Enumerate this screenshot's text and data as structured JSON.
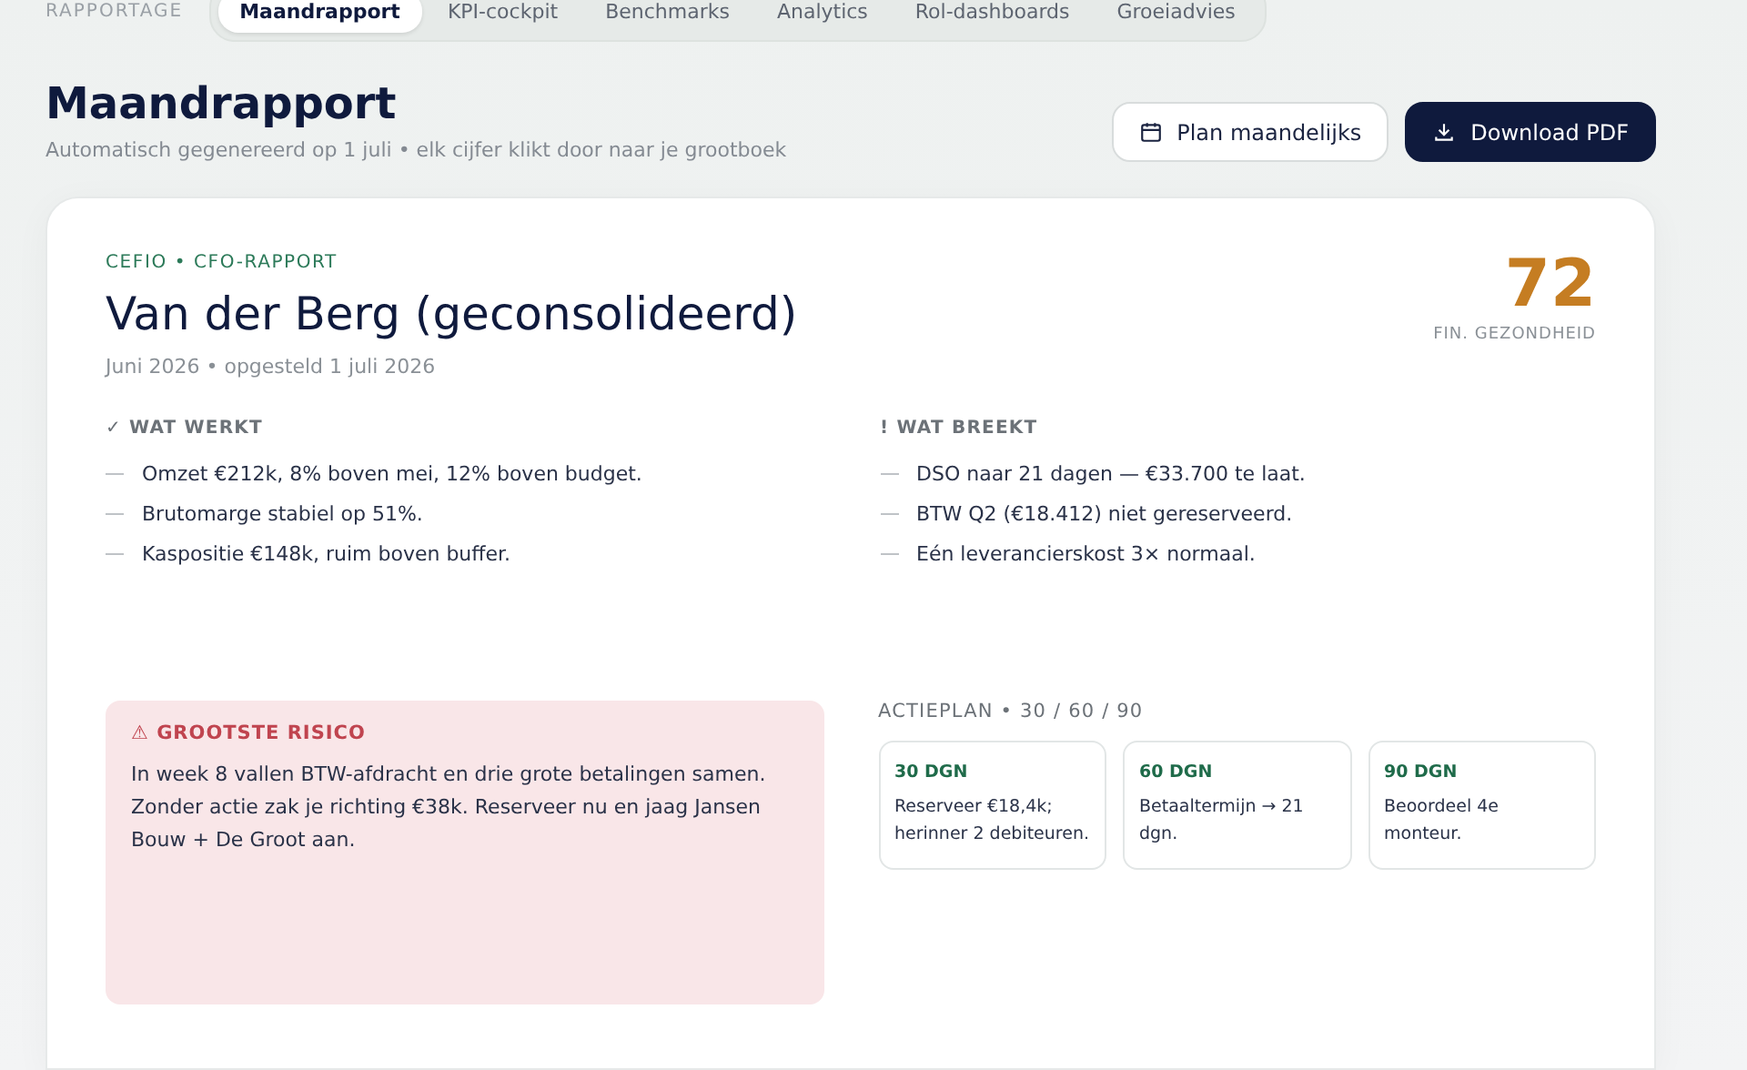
{
  "section_label": "RAPPORTAGE",
  "tabs": [
    {
      "label": "Maandrapport",
      "selected": true
    },
    {
      "label": "KPI-cockpit",
      "selected": false
    },
    {
      "label": "Benchmarks",
      "selected": false
    },
    {
      "label": "Analytics",
      "selected": false
    },
    {
      "label": "Rol-dashboards",
      "selected": false
    },
    {
      "label": "Groeiadvies",
      "selected": false
    }
  ],
  "header": {
    "title": "Maandrapport",
    "subtitle": "Automatisch gegenereerd op 1 juli • elk cijfer klikt door naar je grootboek"
  },
  "buttons": [
    {
      "label": "Plan maandelijks",
      "kind": "secondary"
    },
    {
      "label": "Download PDF",
      "kind": "primary"
    }
  ],
  "report": {
    "eyebrow": "CEFIO • CFO-RAPPORT",
    "title": "Van der Berg (geconsolideerd)",
    "meta": "Juni 2026 • opgesteld 1 juli 2026",
    "score": {
      "value": "72",
      "label": "FIN. GEZONDHEID"
    },
    "columns": [
      {
        "heading": "✓ WAT WERKT",
        "items": [
          "Omzet €212k, 8% boven mei, 12% boven budget.",
          "Brutomarge stabiel op 51%.",
          "Kaspositie €148k, ruim boven buffer."
        ]
      },
      {
        "heading": "! WAT BREEKT",
        "items": [
          "DSO naar 21 dagen — €33.700 te laat.",
          "BTW Q2 (€18.412) niet gereserveerd.",
          "Eén leverancierskost 3× normaal."
        ]
      }
    ],
    "risk": {
      "heading": "⚠ GROOTSTE RISICO",
      "text": "In week 8 vallen BTW-afdracht en drie grote betalingen samen. Zonder actie zak je richting €38k. Reserveer nu en jaag Jansen Bouw + De Groot aan."
    },
    "actionplan": {
      "heading": "ACTIEPLAN • 30 / 60 / 90",
      "steps": [
        {
          "term": "30 DGN",
          "text": "Reserveer €18,4k; herinner 2 debiteuren."
        },
        {
          "term": "60 DGN",
          "text": "Betaaltermijn → 21 dgn."
        },
        {
          "term": "90 DGN",
          "text": "Beoordeel 4e monteur."
        }
      ]
    }
  }
}
